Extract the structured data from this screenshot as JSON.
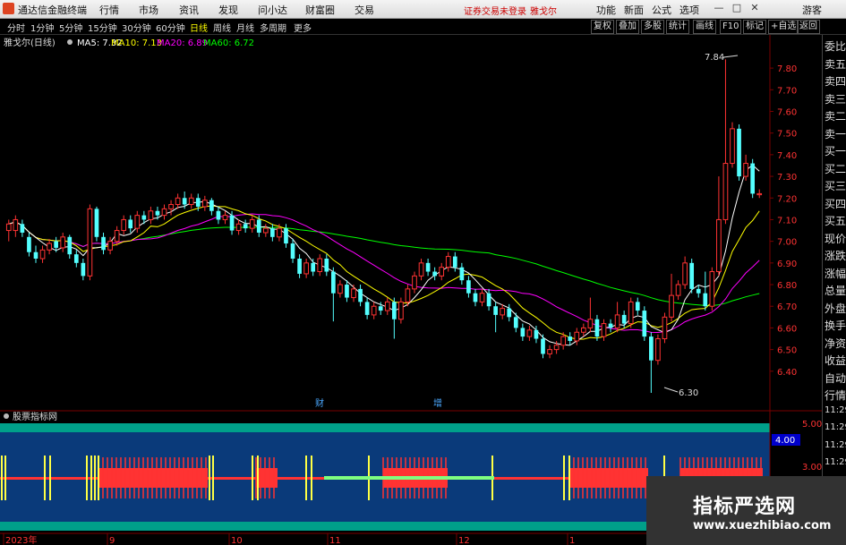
{
  "titlebar": {
    "app_name": "通达信金融终端",
    "menu": [
      "行情",
      "市场",
      "资讯",
      "发现",
      "问小达",
      "财富圈",
      "交易"
    ],
    "notice": "证券交易未登录",
    "stock": "雅戈尔",
    "right_menu": [
      "功能",
      "新面",
      "公式",
      "选项",
      "游客"
    ],
    "window_buttons": [
      "—",
      "□",
      "✕"
    ]
  },
  "toolbar": {
    "periods": [
      "分时",
      "1分钟",
      "5分钟",
      "15分钟",
      "30分钟",
      "60分钟",
      "日线",
      "周线",
      "月线",
      "多周期",
      "更多"
    ],
    "active_period": "日线",
    "buttons": [
      "复权",
      "叠加",
      "多股",
      "统计",
      "画线",
      "F10",
      "标记",
      "+自选",
      "返回"
    ]
  },
  "legend": {
    "name": "雅戈尔(日线)",
    "ma5": "MA5: 7.32",
    "ma10": "MA10: 7.13",
    "ma20": "MA20: 6.89",
    "ma60": "MA60: 6.72",
    "colors": {
      "ma5": "#ffffff",
      "ma10": "#ffff00",
      "ma20": "#ff00ff",
      "ma60": "#00ff00"
    }
  },
  "price_axis": [
    "7.80",
    "7.70",
    "7.60",
    "7.50",
    "7.40",
    "7.30",
    "7.20",
    "7.10",
    "7.00",
    "6.90",
    "6.80",
    "6.70",
    "6.60",
    "6.50",
    "6.40"
  ],
  "annotations": {
    "high": "7.84",
    "low": "6.30",
    "event1": "财",
    "event2": "增"
  },
  "indicator": {
    "title": "股票指标网",
    "axis": [
      "5.00",
      "4.00",
      "3.00"
    ],
    "current": "4.00"
  },
  "date_axis": [
    "2023年",
    "9",
    "10",
    "11",
    "12",
    "1"
  ],
  "right_panel": [
    "委比",
    "卖五",
    "卖四",
    "卖三",
    "卖二",
    "卖一",
    "买一",
    "买二",
    "买三",
    "买四",
    "买五",
    "现价",
    "涨跌",
    "涨幅",
    "总量",
    "外盘",
    "换手",
    "净资",
    "收益",
    "自动",
    "行情",
    "11:29",
    "11:29",
    "11:29",
    "11:29",
    "11:29",
    "11:29",
    "11:29"
  ],
  "watermark": {
    "line1": "指标严选网",
    "line2": "www.xuezhibiao.com"
  },
  "colors": {
    "up": "#ff3333",
    "down": "#54ffff",
    "grid": "#7a0000",
    "indicator_bg": "#0a3a7a",
    "indicator_border": "#00a08a"
  },
  "chart_data": {
    "type": "candlestick",
    "ylim": [
      6.3,
      7.85
    ],
    "high_label": 7.84,
    "low_label": 6.3,
    "candles": [
      [
        7.05,
        7.08,
        7.0,
        7.1
      ],
      [
        7.05,
        7.1,
        7.02,
        7.12
      ],
      [
        7.08,
        7.04,
        7.02,
        7.1
      ],
      [
        7.02,
        6.95,
        6.93,
        7.04
      ],
      [
        6.95,
        6.92,
        6.9,
        6.98
      ],
      [
        6.92,
        6.96,
        6.9,
        6.98
      ],
      [
        6.96,
        6.99,
        6.94,
        7.01
      ],
      [
        7.0,
        6.97,
        6.95,
        7.02
      ],
      [
        6.97,
        7.02,
        6.95,
        7.04
      ],
      [
        7.02,
        6.94,
        6.92,
        7.03
      ],
      [
        6.94,
        6.9,
        6.88,
        6.96
      ],
      [
        6.9,
        6.84,
        6.82,
        6.92
      ],
      [
        6.84,
        7.15,
        6.82,
        7.17
      ],
      [
        7.15,
        7.02,
        7.0,
        7.16
      ],
      [
        7.02,
        6.96,
        6.94,
        7.04
      ],
      [
        6.96,
        7.0,
        6.94,
        7.02
      ],
      [
        7.0,
        7.05,
        6.98,
        7.07
      ],
      [
        7.05,
        7.1,
        7.03,
        7.12
      ],
      [
        7.1,
        7.06,
        7.04,
        7.12
      ],
      [
        7.06,
        7.12,
        7.04,
        7.14
      ],
      [
        7.12,
        7.1,
        7.08,
        7.14
      ],
      [
        7.1,
        7.14,
        7.08,
        7.16
      ],
      [
        7.14,
        7.12,
        7.1,
        7.16
      ],
      [
        7.12,
        7.15,
        7.1,
        7.17
      ],
      [
        7.15,
        7.17,
        7.12,
        7.19
      ],
      [
        7.17,
        7.2,
        7.15,
        7.22
      ],
      [
        7.2,
        7.17,
        7.15,
        7.23
      ],
      [
        7.17,
        7.2,
        7.15,
        7.22
      ],
      [
        7.2,
        7.16,
        7.14,
        7.22
      ],
      [
        7.16,
        7.19,
        7.14,
        7.21
      ],
      [
        7.19,
        7.14,
        7.12,
        7.2
      ],
      [
        7.14,
        7.1,
        7.08,
        7.16
      ],
      [
        7.1,
        7.12,
        7.08,
        7.14
      ],
      [
        7.12,
        7.05,
        7.03,
        7.14
      ],
      [
        7.05,
        7.08,
        7.03,
        7.1
      ],
      [
        7.08,
        7.06,
        7.04,
        7.1
      ],
      [
        7.06,
        7.1,
        7.04,
        7.12
      ],
      [
        7.1,
        7.04,
        7.02,
        7.12
      ],
      [
        7.04,
        7.06,
        7.02,
        7.08
      ],
      [
        7.06,
        7.02,
        7.0,
        7.08
      ],
      [
        7.02,
        7.06,
        7.0,
        7.08
      ],
      [
        7.06,
        6.99,
        6.97,
        7.08
      ],
      [
        6.99,
        6.92,
        6.9,
        7.01
      ],
      [
        6.92,
        6.85,
        6.83,
        6.94
      ],
      [
        6.85,
        6.9,
        6.83,
        6.92
      ],
      [
        6.9,
        6.86,
        6.84,
        6.92
      ],
      [
        6.86,
        6.92,
        6.84,
        6.94
      ],
      [
        6.92,
        6.86,
        6.84,
        6.94
      ],
      [
        6.86,
        6.76,
        6.63,
        6.88
      ],
      [
        6.76,
        6.8,
        6.74,
        6.82
      ],
      [
        6.8,
        6.74,
        6.72,
        6.82
      ],
      [
        6.74,
        6.78,
        6.72,
        6.8
      ],
      [
        6.78,
        6.72,
        6.7,
        6.8
      ],
      [
        6.72,
        6.66,
        6.64,
        6.74
      ],
      [
        6.66,
        6.7,
        6.64,
        6.72
      ],
      [
        6.7,
        6.68,
        6.66,
        6.72
      ],
      [
        6.68,
        6.72,
        6.66,
        6.74
      ],
      [
        6.72,
        6.64,
        6.55,
        6.74
      ],
      [
        6.64,
        6.72,
        6.62,
        6.74
      ],
      [
        6.72,
        6.78,
        6.7,
        6.8
      ],
      [
        6.78,
        6.84,
        6.76,
        6.86
      ],
      [
        6.84,
        6.9,
        6.82,
        6.92
      ],
      [
        6.9,
        6.86,
        6.84,
        6.92
      ],
      [
        6.86,
        6.84,
        6.82,
        6.88
      ],
      [
        6.84,
        6.88,
        6.82,
        6.9
      ],
      [
        6.88,
        6.93,
        6.86,
        6.95
      ],
      [
        6.93,
        6.88,
        6.86,
        6.95
      ],
      [
        6.88,
        6.82,
        6.8,
        6.9
      ],
      [
        6.82,
        6.76,
        6.74,
        6.84
      ],
      [
        6.76,
        6.72,
        6.7,
        6.78
      ],
      [
        6.72,
        6.76,
        6.7,
        6.78
      ],
      [
        6.76,
        6.7,
        6.68,
        6.78
      ],
      [
        6.7,
        6.66,
        6.58,
        6.72
      ],
      [
        6.66,
        6.69,
        6.64,
        6.71
      ],
      [
        6.69,
        6.65,
        6.63,
        6.71
      ],
      [
        6.65,
        6.6,
        6.58,
        6.67
      ],
      [
        6.6,
        6.56,
        6.54,
        6.62
      ],
      [
        6.56,
        6.59,
        6.54,
        6.61
      ],
      [
        6.59,
        6.55,
        6.53,
        6.61
      ],
      [
        6.55,
        6.48,
        6.46,
        6.57
      ],
      [
        6.48,
        6.5,
        6.46,
        6.52
      ],
      [
        6.5,
        6.52,
        6.48,
        6.54
      ],
      [
        6.52,
        6.56,
        6.5,
        6.58
      ],
      [
        6.56,
        6.54,
        6.52,
        6.58
      ],
      [
        6.54,
        6.58,
        6.52,
        6.6
      ],
      [
        6.58,
        6.6,
        6.56,
        6.62
      ],
      [
        6.6,
        6.64,
        6.58,
        6.74
      ],
      [
        6.64,
        6.56,
        6.54,
        6.66
      ],
      [
        6.56,
        6.62,
        6.54,
        6.64
      ],
      [
        6.62,
        6.6,
        6.58,
        6.64
      ],
      [
        6.6,
        6.66,
        6.58,
        6.72
      ],
      [
        6.66,
        6.62,
        6.6,
        6.68
      ],
      [
        6.62,
        6.72,
        6.6,
        6.74
      ],
      [
        6.72,
        6.68,
        6.66,
        6.74
      ],
      [
        6.68,
        6.56,
        6.54,
        6.7
      ],
      [
        6.56,
        6.45,
        6.3,
        6.58
      ],
      [
        6.45,
        6.55,
        6.43,
        6.57
      ],
      [
        6.55,
        6.65,
        6.53,
        6.67
      ],
      [
        6.65,
        6.75,
        6.63,
        6.85
      ],
      [
        6.75,
        6.8,
        6.73,
        6.82
      ],
      [
        6.8,
        6.9,
        6.78,
        6.93
      ],
      [
        6.9,
        6.78,
        6.76,
        6.92
      ],
      [
        6.78,
        6.76,
        6.74,
        6.8
      ],
      [
        6.76,
        6.7,
        6.68,
        6.86
      ],
      [
        6.7,
        6.86,
        6.68,
        6.88
      ],
      [
        6.86,
        7.1,
        6.84,
        7.3
      ],
      [
        7.1,
        7.36,
        7.08,
        7.84
      ],
      [
        7.36,
        7.52,
        7.34,
        7.55
      ],
      [
        7.52,
        7.3,
        7.28,
        7.54
      ],
      [
        7.3,
        7.36,
        7.28,
        7.4
      ],
      [
        7.36,
        7.22,
        7.2,
        7.38
      ],
      [
        7.22,
        7.22,
        7.2,
        7.24
      ]
    ]
  }
}
